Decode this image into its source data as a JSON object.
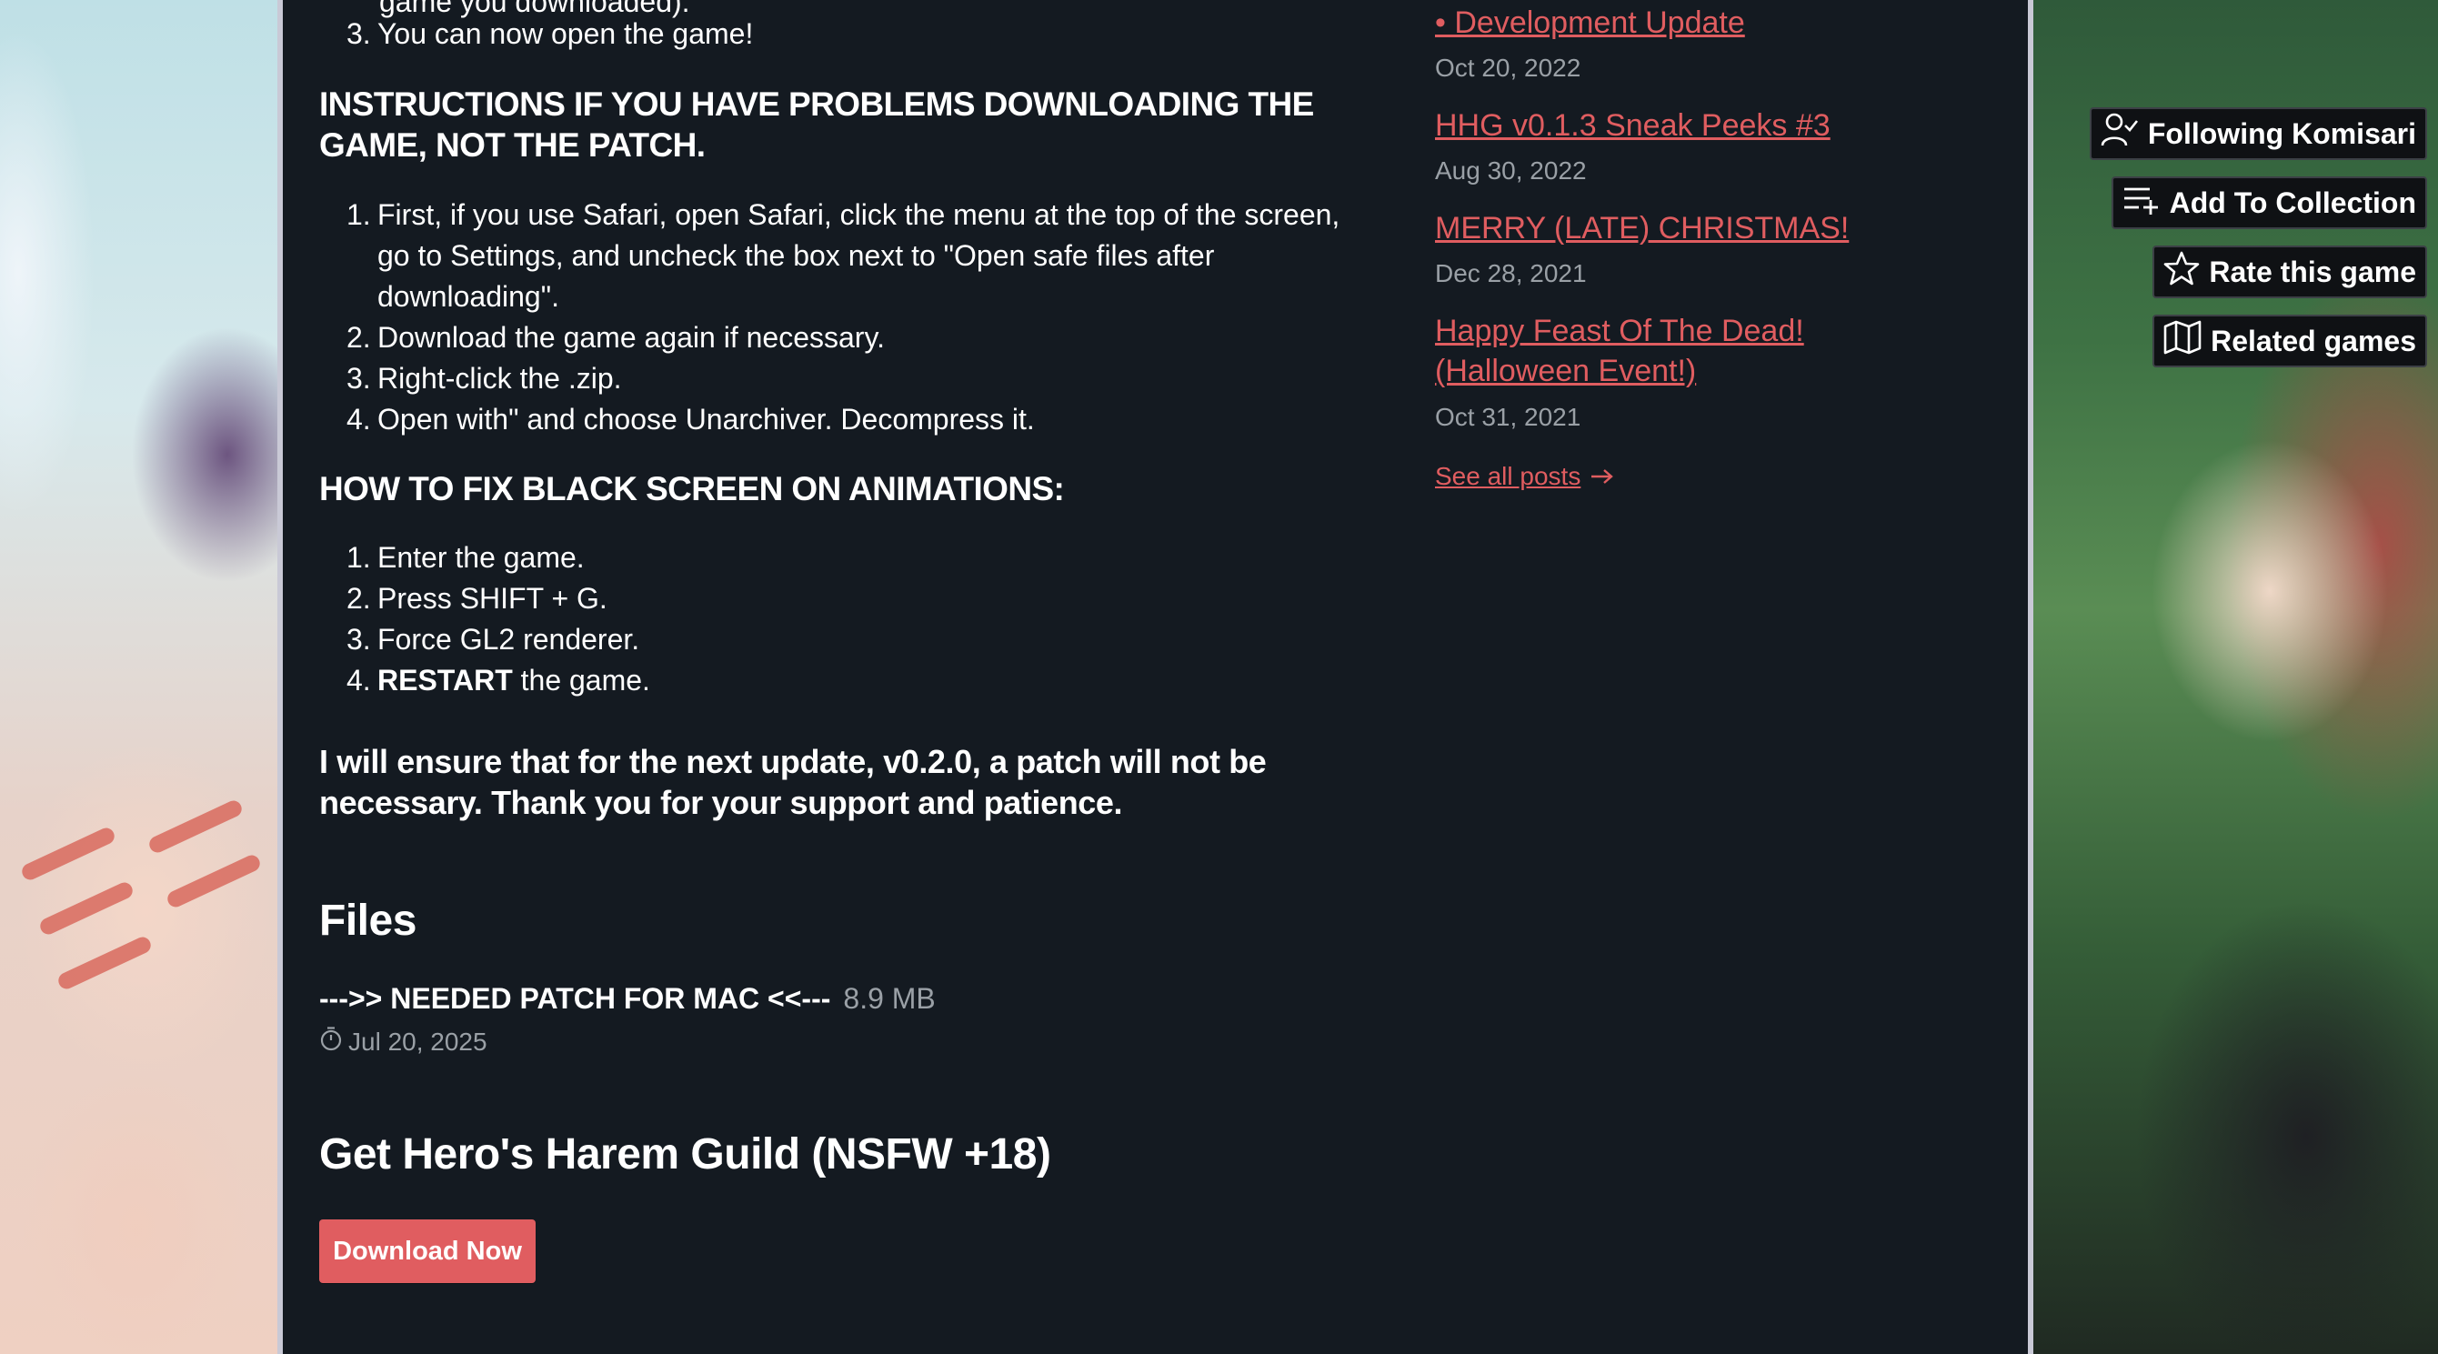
{
  "description": {
    "partial_line": "game you downloaded).",
    "install_steps_tail": [
      {
        "num": "3.",
        "text": "You can now open the game!"
      }
    ],
    "download_problems_heading": "INSTRUCTIONS IF YOU HAVE PROBLEMS DOWNLOADING THE GAME, NOT THE PATCH.",
    "download_problems_steps": [
      {
        "num": "1.",
        "text": "First, if you use Safari, open Safari, click the menu at the top of the screen, go to Settings, and uncheck the box next to \"Open safe files after downloading\"."
      },
      {
        "num": "2.",
        "text": "Download the game again if necessary."
      },
      {
        "num": "3.",
        "text": "Right-click the .zip."
      },
      {
        "num": "4.",
        "text": "Open with\" and choose Unarchiver. Decompress it."
      }
    ],
    "black_screen_heading": "HOW TO FIX BLACK SCREEN ON ANIMATIONS:",
    "black_screen_steps": [
      {
        "num": "1.",
        "text": "Enter the game."
      },
      {
        "num": "2.",
        "text": "Press SHIFT + G."
      },
      {
        "num": "3.",
        "text": "Force GL2 renderer."
      },
      {
        "num": "4.",
        "bold": "RESTART",
        "text": " the game."
      }
    ],
    "closing_note": "I will ensure that for the next update, v0.2.0, a patch will not be necessary. Thank you for your support and patience."
  },
  "files": {
    "heading": "Files",
    "items": [
      {
        "name": "--->> NEEDED PATCH FOR MAC <<---",
        "size": "8.9 MB",
        "date": "Jul 20, 2025"
      }
    ]
  },
  "purchase": {
    "heading": "Get Hero's Harem Guild (NSFW +18)",
    "download_label": "Download Now"
  },
  "devlog": {
    "posts": [
      {
        "title": "• Development Update",
        "date": "Oct 20, 2022"
      },
      {
        "title": "HHG v0.1.3 Sneak Peeks #3",
        "date": "Aug 30, 2022"
      },
      {
        "title": "MERRY (LATE) CHRISTMAS!",
        "date": "Dec 28, 2021"
      },
      {
        "title": "Happy Feast Of The Dead! (Halloween Event!)",
        "date": "Oct 31, 2021"
      }
    ],
    "see_all_label": "See all posts"
  },
  "actions": {
    "following": "Following Komisari",
    "add_collection": "Add To Collection",
    "rate": "Rate this game",
    "related": "Related games"
  },
  "colors": {
    "panel_bg": "#141a21",
    "accent": "#e05d60",
    "muted_text": "#9aa0a6"
  },
  "icons": [
    "user-check-icon",
    "playlist-add-icon",
    "star-icon",
    "map-icon",
    "clock-icon",
    "arrow-right-icon"
  ]
}
